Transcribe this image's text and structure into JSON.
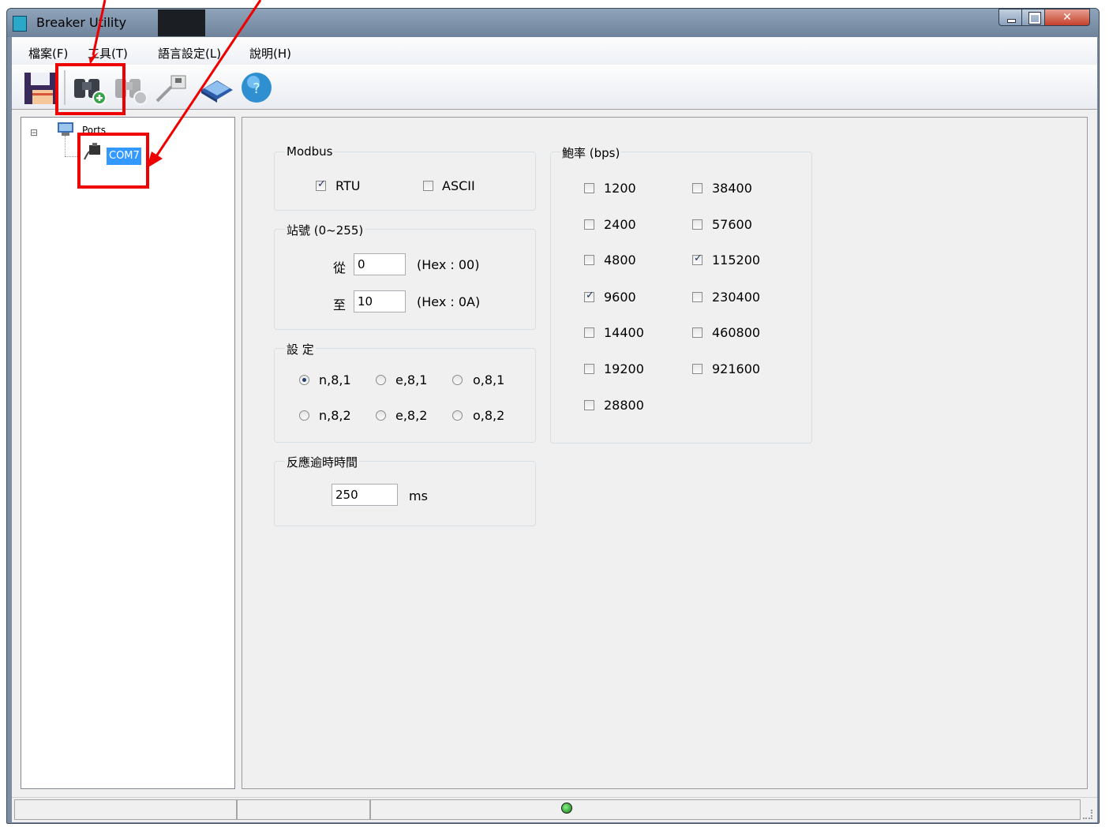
{
  "window": {
    "title": "Breaker Utility"
  },
  "menu": {
    "file": "檔案(F)",
    "tools": "工具(T)",
    "language": "語言設定(L)",
    "help": "說明(H)"
  },
  "toolbar": {
    "icons": [
      "save-icon",
      "search-add-icon",
      "search-remove-icon",
      "connect-icon",
      "manual-icon",
      "help-icon"
    ]
  },
  "tree": {
    "root": "Ports",
    "child": "COM7",
    "expander": "⊟"
  },
  "modbus": {
    "title": "Modbus",
    "rtu": "RTU",
    "ascii": "ASCII",
    "rtu_checked": true,
    "ascii_checked": false
  },
  "station": {
    "title": "站號 (0~255)",
    "from_label": "從",
    "from_value": "0",
    "from_hex": "(Hex : 00)",
    "to_label": "至",
    "to_value": "10",
    "to_hex": "(Hex : 0A)"
  },
  "settings": {
    "title": "設 定",
    "options": [
      "n,8,1",
      "e,8,1",
      "o,8,1",
      "n,8,2",
      "e,8,2",
      "o,8,2"
    ],
    "selected": "n,8,1"
  },
  "timeout": {
    "title": "反應逾時時間",
    "value": "250",
    "unit": "ms"
  },
  "baud": {
    "title": "鮑率 (bps)",
    "left": [
      "1200",
      "2400",
      "4800",
      "9600",
      "14400",
      "19200",
      "28800"
    ],
    "right": [
      "38400",
      "57600",
      "115200",
      "230400",
      "460800",
      "921600"
    ],
    "checked": [
      "9600",
      "115200"
    ]
  },
  "colors": {
    "annotation": "#ee0000",
    "selection": "#3399ff",
    "status_led": "#1faa1f"
  }
}
